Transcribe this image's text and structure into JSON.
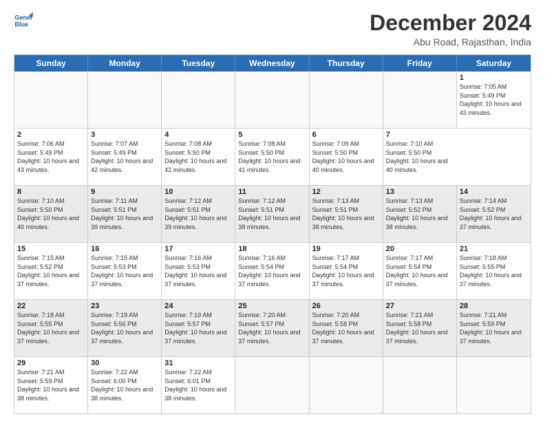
{
  "header": {
    "logo_text_general": "General",
    "logo_text_blue": "Blue",
    "month_title": "December 2024",
    "location": "Abu Road, Rajasthan, India"
  },
  "calendar": {
    "days_of_week": [
      "Sunday",
      "Monday",
      "Tuesday",
      "Wednesday",
      "Thursday",
      "Friday",
      "Saturday"
    ],
    "weeks": [
      [
        {
          "num": "",
          "empty": true,
          "shaded": false,
          "rise": "",
          "set": "",
          "daylight": ""
        },
        {
          "num": "",
          "empty": true,
          "shaded": false,
          "rise": "",
          "set": "",
          "daylight": ""
        },
        {
          "num": "",
          "empty": true,
          "shaded": false,
          "rise": "",
          "set": "",
          "daylight": ""
        },
        {
          "num": "",
          "empty": true,
          "shaded": false,
          "rise": "",
          "set": "",
          "daylight": ""
        },
        {
          "num": "",
          "empty": true,
          "shaded": false,
          "rise": "",
          "set": "",
          "daylight": ""
        },
        {
          "num": "",
          "empty": true,
          "shaded": false,
          "rise": "",
          "set": "",
          "daylight": ""
        },
        {
          "num": "1",
          "empty": false,
          "shaded": false,
          "rise": "Sunrise: 7:05 AM",
          "set": "Sunset: 5:49 PM",
          "daylight": "Daylight: 10 hours and 43 minutes."
        }
      ],
      [
        {
          "num": "2",
          "empty": false,
          "shaded": false,
          "rise": "Sunrise: 7:06 AM",
          "set": "Sunset: 5:49 PM",
          "daylight": "Daylight: 10 hours and 43 minutes."
        },
        {
          "num": "3",
          "empty": false,
          "shaded": false,
          "rise": "Sunrise: 7:07 AM",
          "set": "Sunset: 5:49 PM",
          "daylight": "Daylight: 10 hours and 42 minutes."
        },
        {
          "num": "4",
          "empty": false,
          "shaded": false,
          "rise": "Sunrise: 7:08 AM",
          "set": "Sunset: 5:50 PM",
          "daylight": "Daylight: 10 hours and 42 minutes."
        },
        {
          "num": "5",
          "empty": false,
          "shaded": false,
          "rise": "Sunrise: 7:08 AM",
          "set": "Sunset: 5:50 PM",
          "daylight": "Daylight: 10 hours and 41 minutes."
        },
        {
          "num": "6",
          "empty": false,
          "shaded": false,
          "rise": "Sunrise: 7:09 AM",
          "set": "Sunset: 5:50 PM",
          "daylight": "Daylight: 10 hours and 40 minutes."
        },
        {
          "num": "7",
          "empty": false,
          "shaded": false,
          "rise": "Sunrise: 7:10 AM",
          "set": "Sunset: 5:50 PM",
          "daylight": "Daylight: 10 hours and 40 minutes."
        }
      ],
      [
        {
          "num": "8",
          "empty": false,
          "shaded": true,
          "rise": "Sunrise: 7:10 AM",
          "set": "Sunset: 5:50 PM",
          "daylight": "Daylight: 10 hours and 40 minutes."
        },
        {
          "num": "9",
          "empty": false,
          "shaded": true,
          "rise": "Sunrise: 7:11 AM",
          "set": "Sunset: 5:51 PM",
          "daylight": "Daylight: 10 hours and 39 minutes."
        },
        {
          "num": "10",
          "empty": false,
          "shaded": true,
          "rise": "Sunrise: 7:12 AM",
          "set": "Sunset: 5:51 PM",
          "daylight": "Daylight: 10 hours and 39 minutes."
        },
        {
          "num": "11",
          "empty": false,
          "shaded": true,
          "rise": "Sunrise: 7:12 AM",
          "set": "Sunset: 5:51 PM",
          "daylight": "Daylight: 10 hours and 38 minutes."
        },
        {
          "num": "12",
          "empty": false,
          "shaded": true,
          "rise": "Sunrise: 7:13 AM",
          "set": "Sunset: 5:51 PM",
          "daylight": "Daylight: 10 hours and 38 minutes."
        },
        {
          "num": "13",
          "empty": false,
          "shaded": true,
          "rise": "Sunrise: 7:13 AM",
          "set": "Sunset: 5:52 PM",
          "daylight": "Daylight: 10 hours and 38 minutes."
        },
        {
          "num": "14",
          "empty": false,
          "shaded": true,
          "rise": "Sunrise: 7:14 AM",
          "set": "Sunset: 5:52 PM",
          "daylight": "Daylight: 10 hours and 37 minutes."
        }
      ],
      [
        {
          "num": "15",
          "empty": false,
          "shaded": false,
          "rise": "Sunrise: 7:15 AM",
          "set": "Sunset: 5:52 PM",
          "daylight": "Daylight: 10 hours and 37 minutes."
        },
        {
          "num": "16",
          "empty": false,
          "shaded": false,
          "rise": "Sunrise: 7:15 AM",
          "set": "Sunset: 5:53 PM",
          "daylight": "Daylight: 10 hours and 37 minutes."
        },
        {
          "num": "17",
          "empty": false,
          "shaded": false,
          "rise": "Sunrise: 7:16 AM",
          "set": "Sunset: 5:53 PM",
          "daylight": "Daylight: 10 hours and 37 minutes."
        },
        {
          "num": "18",
          "empty": false,
          "shaded": false,
          "rise": "Sunrise: 7:16 AM",
          "set": "Sunset: 5:54 PM",
          "daylight": "Daylight: 10 hours and 37 minutes."
        },
        {
          "num": "19",
          "empty": false,
          "shaded": false,
          "rise": "Sunrise: 7:17 AM",
          "set": "Sunset: 5:54 PM",
          "daylight": "Daylight: 10 hours and 37 minutes."
        },
        {
          "num": "20",
          "empty": false,
          "shaded": false,
          "rise": "Sunrise: 7:17 AM",
          "set": "Sunset: 5:54 PM",
          "daylight": "Daylight: 10 hours and 37 minutes."
        },
        {
          "num": "21",
          "empty": false,
          "shaded": false,
          "rise": "Sunrise: 7:18 AM",
          "set": "Sunset: 5:55 PM",
          "daylight": "Daylight: 10 hours and 37 minutes."
        }
      ],
      [
        {
          "num": "22",
          "empty": false,
          "shaded": true,
          "rise": "Sunrise: 7:18 AM",
          "set": "Sunset: 5:55 PM",
          "daylight": "Daylight: 10 hours and 37 minutes."
        },
        {
          "num": "23",
          "empty": false,
          "shaded": true,
          "rise": "Sunrise: 7:19 AM",
          "set": "Sunset: 5:56 PM",
          "daylight": "Daylight: 10 hours and 37 minutes."
        },
        {
          "num": "24",
          "empty": false,
          "shaded": true,
          "rise": "Sunrise: 7:19 AM",
          "set": "Sunset: 5:57 PM",
          "daylight": "Daylight: 10 hours and 37 minutes."
        },
        {
          "num": "25",
          "empty": false,
          "shaded": true,
          "rise": "Sunrise: 7:20 AM",
          "set": "Sunset: 5:57 PM",
          "daylight": "Daylight: 10 hours and 37 minutes."
        },
        {
          "num": "26",
          "empty": false,
          "shaded": true,
          "rise": "Sunrise: 7:20 AM",
          "set": "Sunset: 5:58 PM",
          "daylight": "Daylight: 10 hours and 37 minutes."
        },
        {
          "num": "27",
          "empty": false,
          "shaded": true,
          "rise": "Sunrise: 7:21 AM",
          "set": "Sunset: 5:58 PM",
          "daylight": "Daylight: 10 hours and 37 minutes."
        },
        {
          "num": "28",
          "empty": false,
          "shaded": true,
          "rise": "Sunrise: 7:21 AM",
          "set": "Sunset: 5:59 PM",
          "daylight": "Daylight: 10 hours and 37 minutes."
        }
      ],
      [
        {
          "num": "29",
          "empty": false,
          "shaded": false,
          "rise": "Sunrise: 7:21 AM",
          "set": "Sunset: 5:59 PM",
          "daylight": "Daylight: 10 hours and 38 minutes."
        },
        {
          "num": "30",
          "empty": false,
          "shaded": false,
          "rise": "Sunrise: 7:22 AM",
          "set": "Sunset: 6:00 PM",
          "daylight": "Daylight: 10 hours and 38 minutes."
        },
        {
          "num": "31",
          "empty": false,
          "shaded": false,
          "rise": "Sunrise: 7:22 AM",
          "set": "Sunset: 6:01 PM",
          "daylight": "Daylight: 10 hours and 38 minutes."
        },
        {
          "num": "",
          "empty": true,
          "shaded": false,
          "rise": "",
          "set": "",
          "daylight": ""
        },
        {
          "num": "",
          "empty": true,
          "shaded": false,
          "rise": "",
          "set": "",
          "daylight": ""
        },
        {
          "num": "",
          "empty": true,
          "shaded": false,
          "rise": "",
          "set": "",
          "daylight": ""
        },
        {
          "num": "",
          "empty": true,
          "shaded": false,
          "rise": "",
          "set": "",
          "daylight": ""
        }
      ]
    ]
  }
}
